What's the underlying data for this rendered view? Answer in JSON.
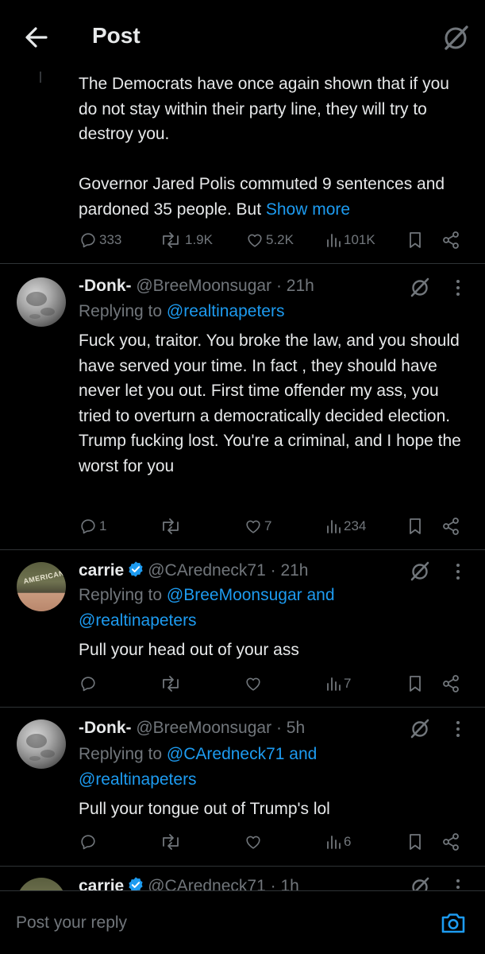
{
  "header": {
    "title": "Post"
  },
  "main_post": {
    "text": "The Democrats have once again shown that if you do not stay within their party line, they will try to destroy you.\n\nGovernor Jared Polis commuted 9 sentences and pardoned 35 people. But",
    "show_more": "Show more",
    "replies": "333",
    "reposts": "1.9K",
    "likes": "5.2K",
    "views": "101K"
  },
  "replies": [
    {
      "name": "-Donk-",
      "handle": "@BreeMoonsugar",
      "time": "· 21h",
      "replying_prefix": "Replying to",
      "replying_to": "@realtinapeters",
      "text": "Fuck you, traitor. You broke the law, and you should have served your time. In fact , they should have never let you out. First time offender my ass, you tried to overturn a democratically decided election. Trump fucking lost. You're a criminal, and I hope the worst for you",
      "replies": "1",
      "reposts": "",
      "likes": "7",
      "views": "234"
    },
    {
      "name": "carrie",
      "handle": "@CAredneck71",
      "time": "· 21h",
      "replying_prefix": "Replying to",
      "replying_to": "@BreeMoonsugar and @realtinapeters",
      "text": "Pull your head out of your ass",
      "avatar_text": "AMERICAN",
      "replies": "",
      "reposts": "",
      "likes": "",
      "views": "7"
    },
    {
      "name": "-Donk-",
      "handle": "@BreeMoonsugar",
      "time": "· 5h",
      "replying_prefix": "Replying to",
      "replying_to": "@CAredneck71 and @realtinapeters",
      "text": "Pull your tongue out of Trump's lol",
      "replies": "",
      "reposts": "",
      "likes": "",
      "views": "6"
    },
    {
      "name": "carrie",
      "handle": "@CAredneck71",
      "time": "· 1h"
    }
  ],
  "reply_bar": {
    "placeholder": "Post your reply"
  },
  "colors": {
    "background": "#000000",
    "text": "#e7e9ea",
    "muted": "#71767b",
    "accent": "#1d9bf0",
    "divider": "#2f3336"
  }
}
